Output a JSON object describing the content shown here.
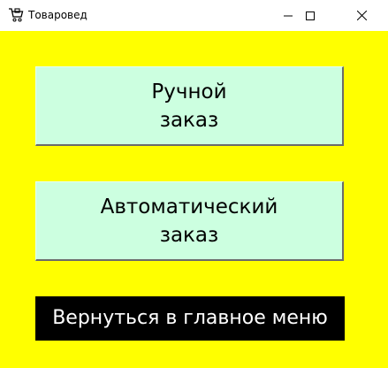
{
  "window": {
    "title": "Товаровед",
    "icon": "shopping-cart-icon",
    "controls": {
      "minimize": "minimize-icon",
      "maximize": "maximize-icon",
      "close": "close-icon"
    }
  },
  "buttons": {
    "manual_order": {
      "line1": "Ручной",
      "line2": "заказ"
    },
    "auto_order": {
      "line1": "Автоматический",
      "line2": "заказ"
    },
    "back_to_menu": "Вернуться в главное меню"
  },
  "colors": {
    "background": "#ffff00",
    "button_fill": "#ccffe0",
    "back_button_fill": "#000000",
    "back_button_text": "#ffffff"
  }
}
